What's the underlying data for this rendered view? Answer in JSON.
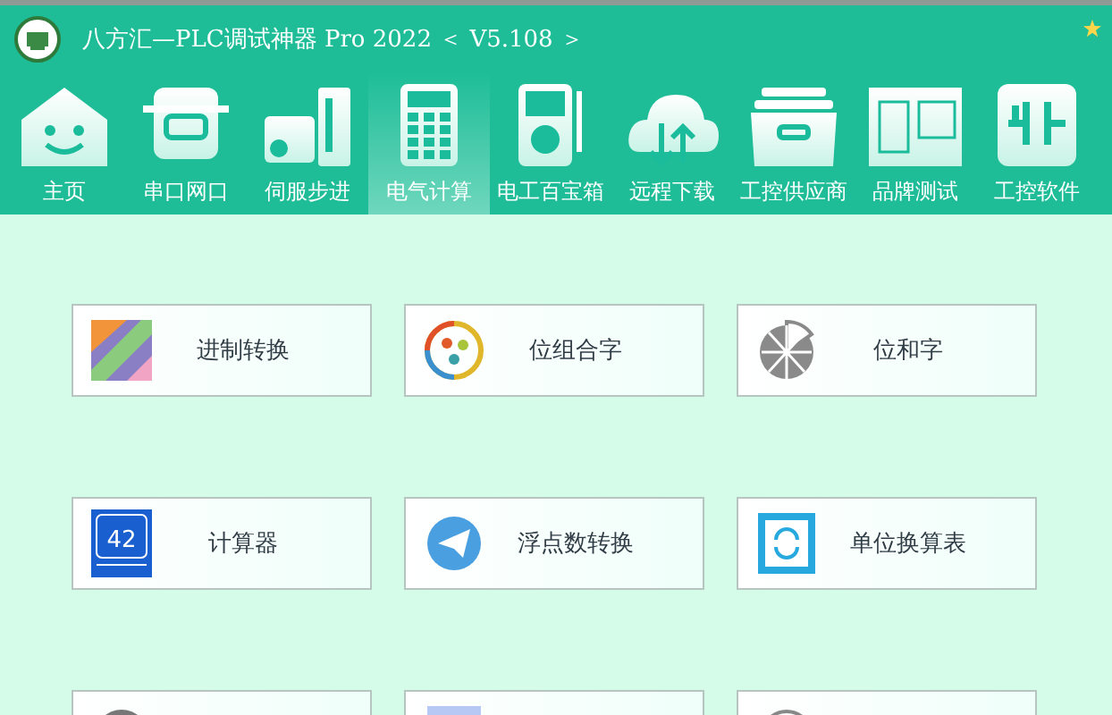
{
  "window": {
    "title": "八方汇—PLC调试神器 Pro 2022 ＜ V5.108 ＞"
  },
  "nav": [
    {
      "label": "主页",
      "kind": "home",
      "selected": false
    },
    {
      "label": "串口网口",
      "kind": "port",
      "selected": false
    },
    {
      "label": "伺服步进",
      "kind": "servo",
      "selected": false
    },
    {
      "label": "电气计算",
      "kind": "calculator",
      "selected": true
    },
    {
      "label": "电工百宝箱",
      "kind": "meter",
      "selected": false
    },
    {
      "label": "远程下载",
      "kind": "cloud",
      "selected": false
    },
    {
      "label": "工控供应商",
      "kind": "drawer",
      "selected": false
    },
    {
      "label": "品牌测试",
      "kind": "plc",
      "selected": false
    },
    {
      "label": "工控软件",
      "kind": "contact",
      "selected": false
    }
  ],
  "tools": [
    {
      "label": "进制转换",
      "kind": "base"
    },
    {
      "label": "位组合字",
      "kind": "wheel"
    },
    {
      "label": "位和字",
      "kind": "pie"
    },
    {
      "label": "计算器",
      "kind": "calc",
      "icon_text": "42"
    },
    {
      "label": "浮点数转换",
      "kind": "plane"
    },
    {
      "label": "单位换算表",
      "kind": "convert"
    },
    {
      "kind": "partial-grey"
    },
    {
      "kind": "partial-blue"
    },
    {
      "kind": "partial-ring"
    }
  ]
}
